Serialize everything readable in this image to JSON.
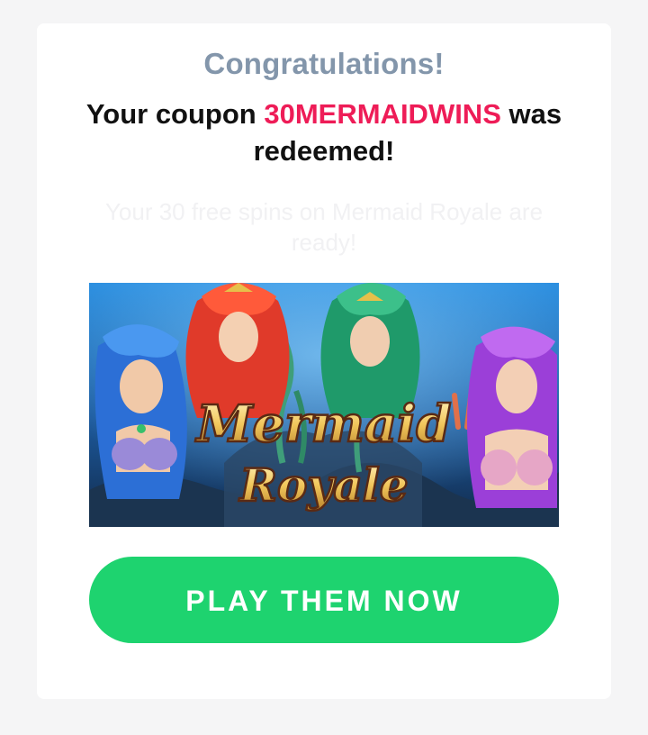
{
  "modal": {
    "heading": "Congratulations!",
    "coupon_prefix": "Your coupon ",
    "coupon_code": "30MERMAIDWINS",
    "coupon_suffix": " was redeemed!",
    "subtext": "Your 30 free spins on Mermaid Royale are ready!",
    "banner": {
      "logo_line1": "Mermaid",
      "logo_line2": "Royale"
    },
    "cta_label": "PLAY THEM NOW"
  },
  "colors": {
    "heading": "#8396ab",
    "coupon_code": "#ee1c57",
    "cta_background": "#1ed36f",
    "cta_text": "#ffffff"
  }
}
